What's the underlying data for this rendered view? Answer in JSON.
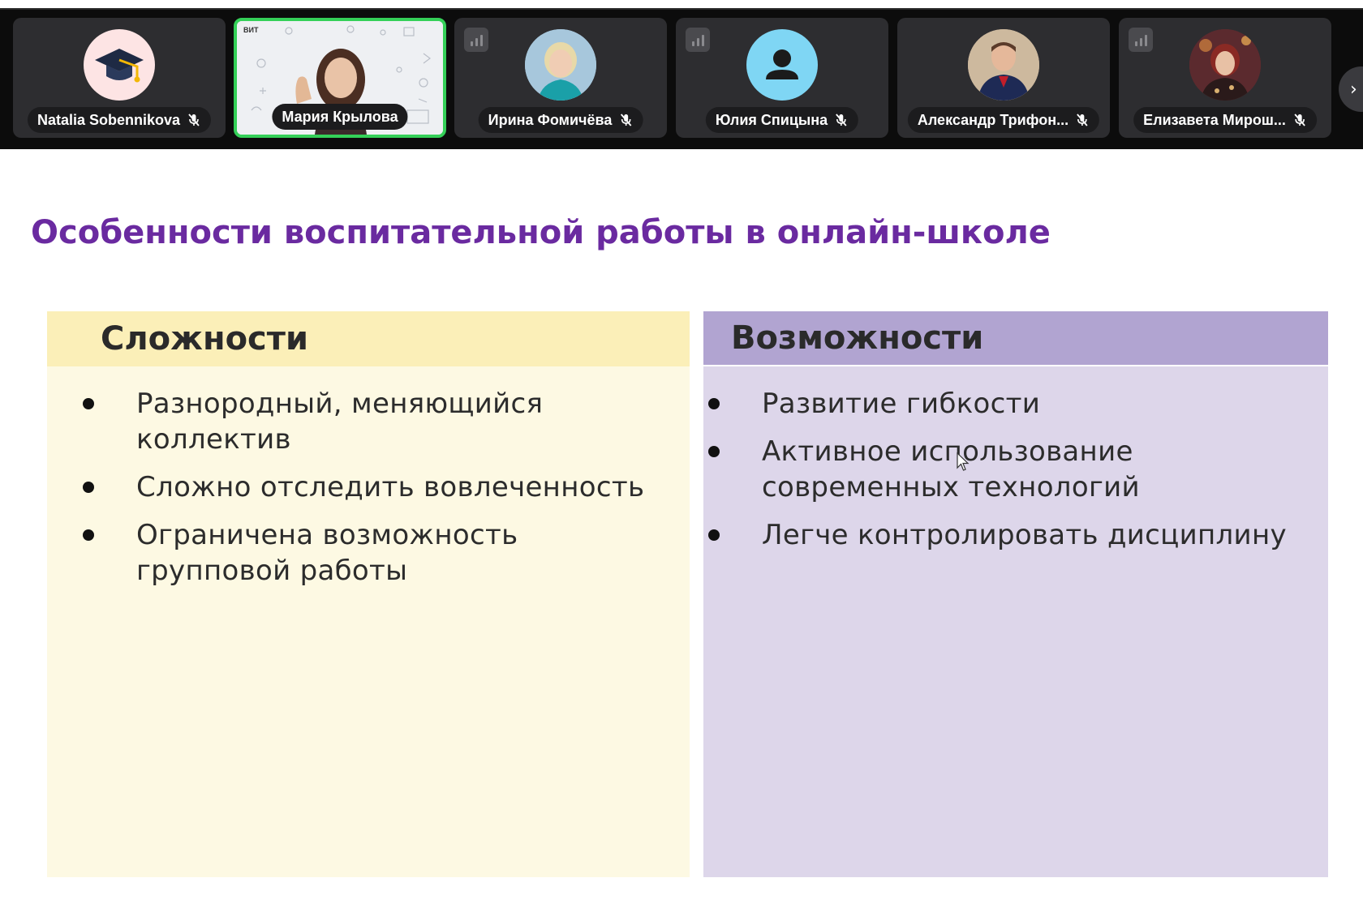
{
  "participants": [
    {
      "name": "Natalia Sobennikova",
      "avatar": "graduation-cap-avatar",
      "muted": true,
      "active": false
    },
    {
      "name": "Мария Крылова",
      "avatar": "video-feed",
      "muted": false,
      "active": true
    },
    {
      "name": "Ирина Фомичёва",
      "avatar": "photo-avatar",
      "muted": true,
      "active": false
    },
    {
      "name": "Юлия Спицына",
      "avatar": "person-silhouette-avatar",
      "muted": true,
      "active": false
    },
    {
      "name": "Александр Трифон...",
      "avatar": "photo-avatar",
      "muted": true,
      "active": false
    },
    {
      "name": "Елизавета Мирош...",
      "avatar": "photo-avatar",
      "muted": true,
      "active": false
    }
  ],
  "slide": {
    "title": "Особенности воспитательной работы в онлайн-школе",
    "left": {
      "heading": "Сложности",
      "items": [
        "Разнородный, меняющийся коллектив",
        "Сложно отследить вовлеченность",
        "Ограничена возможность групповой работы"
      ]
    },
    "right": {
      "heading": "Возможности",
      "items": [
        "Развитие гибкости",
        "Активное использование современных технологий",
        "Легче контролировать дисциплину"
      ]
    }
  },
  "colors": {
    "title": "#6a2aa0",
    "left_header": "#fbefb8",
    "left_body": "#fdf9e3",
    "right_header": "#b1a4d1",
    "right_body": "#ddd6ea",
    "active_speaker_border": "#34d058"
  }
}
